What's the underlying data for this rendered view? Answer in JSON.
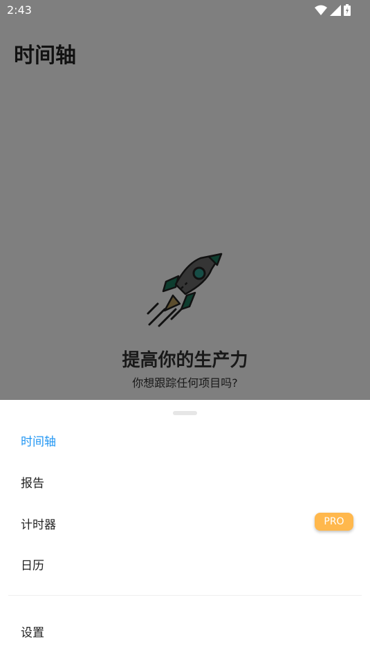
{
  "status_bar": {
    "time": "2:43"
  },
  "app": {
    "title": "时间轴"
  },
  "empty_state": {
    "title": "提高你的生产力",
    "subtitle": "你想跟踪任何项目吗?"
  },
  "menu": {
    "items": [
      {
        "label": "时间轴",
        "active": true
      },
      {
        "label": "报告"
      },
      {
        "label": "计时器",
        "badge": "PRO"
      },
      {
        "label": "日历"
      }
    ],
    "settings_label": "设置"
  },
  "colors": {
    "accent": "#2196f3",
    "pro_badge": "#ffb84d",
    "rocket_green": "#1d7a5f",
    "rocket_flame": "#b89a5a"
  },
  "icons": [
    "wifi-icon",
    "signal-icon",
    "battery-icon",
    "rocket-icon"
  ]
}
